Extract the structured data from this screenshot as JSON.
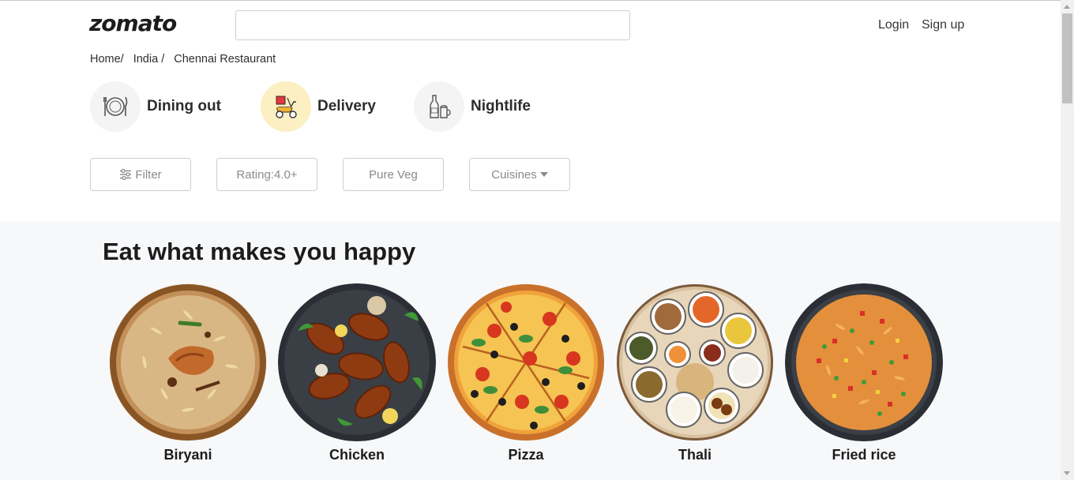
{
  "header": {
    "logo": "zomato",
    "search_value": "",
    "search_placeholder": "",
    "login_label": "Login",
    "signup_label": "Sign up"
  },
  "breadcrumb": [
    "Home/",
    "India /",
    "Chennai Restaurant"
  ],
  "categories": [
    {
      "label": "Dining out",
      "icon": "dining-plate-icon",
      "active": false
    },
    {
      "label": "Delivery",
      "icon": "delivery-scooter-icon",
      "active": true
    },
    {
      "label": "Nightlife",
      "icon": "nightlife-bottle-icon",
      "active": false
    }
  ],
  "filters": {
    "filter_label": "Filter",
    "rating_label": "Rating:4.0+",
    "pureveg_label": "Pure Veg",
    "cuisines_label": "Cuisines"
  },
  "section": {
    "title": "Eat what makes you happy",
    "dishes": [
      {
        "name": "Biryani",
        "image": "biryani-bowl-image"
      },
      {
        "name": "Chicken",
        "image": "chicken-drumsticks-image"
      },
      {
        "name": "Pizza",
        "image": "pizza-image"
      },
      {
        "name": "Thali",
        "image": "thali-platter-image"
      },
      {
        "name": "Fried rice",
        "image": "fried-rice-image"
      }
    ]
  },
  "colors": {
    "delivery_active_bg": "#fcefc2",
    "section_bg": "#f7f8fa",
    "brand_text": "#1c1c1c"
  }
}
